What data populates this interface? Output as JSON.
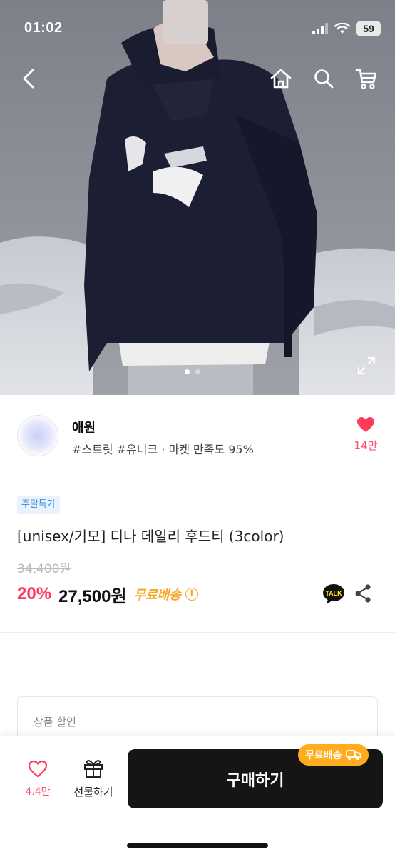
{
  "status_bar": {
    "time": "01:02",
    "battery": "59"
  },
  "nav": {
    "back_icon": "chevron-left-icon",
    "home_icon": "home-icon",
    "search_icon": "search-icon",
    "cart_icon": "cart-icon"
  },
  "gallery": {
    "pages": 2,
    "current_page": 1
  },
  "shop": {
    "name": "애원",
    "tags": "#스트릿 #유니크 · 마켓 만족도 95%",
    "likes": "14만"
  },
  "product": {
    "badge": "주말특가",
    "title": "[unisex/기모] 디나 데일리 후드티 (3color)",
    "original_price": "34,400원",
    "discount": "20%",
    "price": "27,500원",
    "free_shipping": "무료배송",
    "kakao_label": "TALK"
  },
  "discount_section": {
    "title": "상품 할인"
  },
  "bottom_bar": {
    "like_count": "4.4만",
    "gift_label": "선물하기",
    "buy_label": "구매하기",
    "ship_pill": "무료배송"
  },
  "colors": {
    "accent_pink": "#ff3b5c",
    "orange": "#f5a623",
    "badge_blue": "#3a86d8",
    "buy_button": "#151515"
  }
}
